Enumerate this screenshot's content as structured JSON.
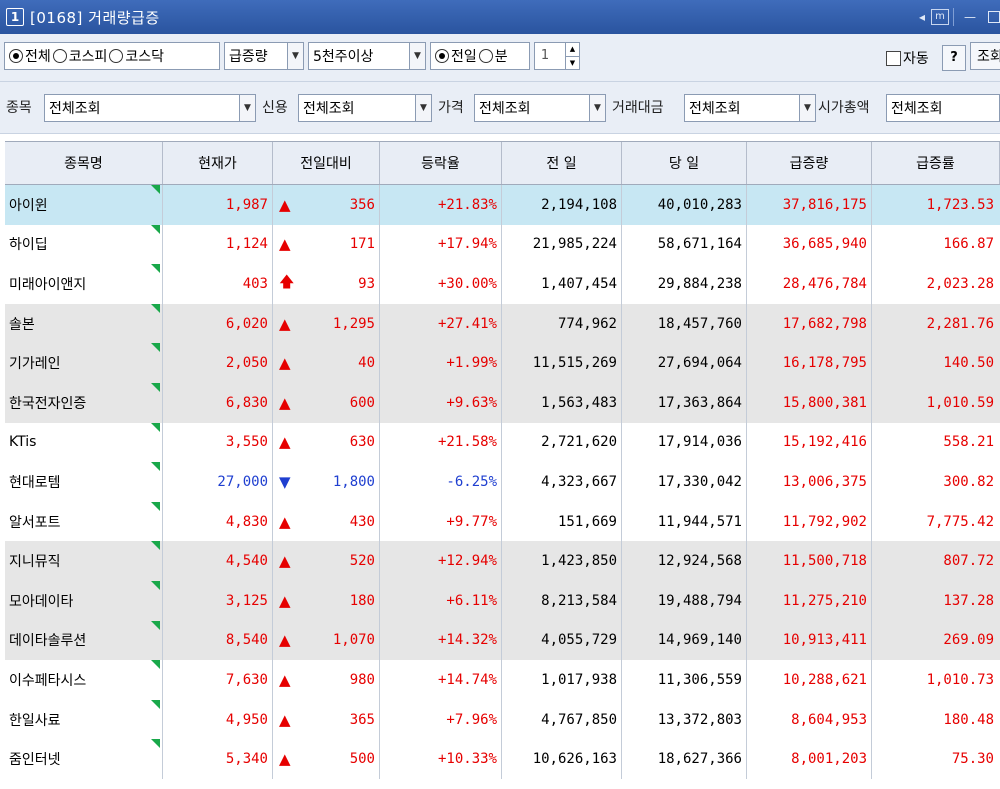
{
  "window": {
    "screen_number": "1",
    "title": "[0168] 거래량급증",
    "m_label": "m",
    "minimize": "—",
    "arrow": "◂"
  },
  "filters1": {
    "market_options": [
      "전체",
      "코스피",
      "코스닥"
    ],
    "market_selected": "전체",
    "sort_select": "급증량",
    "volume_select": "5천주이상",
    "period_options": [
      "전일",
      "분"
    ],
    "period_selected": "전일",
    "minute_value": "1",
    "auto_label": "자동",
    "help_label": "?",
    "query_label": "조회"
  },
  "filters2": {
    "stock_label": "종목",
    "stock_value": "전체조회",
    "credit_label": "신용",
    "credit_value": "전체조회",
    "price_label": "가격",
    "price_value": "전체조회",
    "amount_label": "거래대금",
    "amount_value": "전체조회",
    "cap_label": "시가총액",
    "cap_value": "전체조회"
  },
  "table": {
    "headers": [
      "종목명",
      "현재가",
      "전일대비",
      "등락율",
      "전 일",
      "당 일",
      "급증량",
      "급증률"
    ],
    "rows": [
      {
        "name": "아이윈",
        "price": "1,987",
        "sign": "▲",
        "diff": "356",
        "rate": "+21.83%",
        "prev": "2,194,108",
        "today": "40,010,283",
        "inc": "37,816,175",
        "incr": "1,723.53",
        "dir": "up",
        "bg": "sel"
      },
      {
        "name": "하이딥",
        "price": "1,124",
        "sign": "▲",
        "diff": "171",
        "rate": "+17.94%",
        "prev": "21,985,224",
        "today": "58,671,164",
        "inc": "36,685,940",
        "incr": "166.87",
        "dir": "up",
        "bg": "white"
      },
      {
        "name": "미래아이앤지",
        "price": "403",
        "sign": "🡅",
        "diff": "93",
        "rate": "+30.00%",
        "prev": "1,407,454",
        "today": "29,884,238",
        "inc": "28,476,784",
        "incr": "2,023.28",
        "dir": "up",
        "bg": "white"
      },
      {
        "name": "솔본",
        "price": "6,020",
        "sign": "▲",
        "diff": "1,295",
        "rate": "+27.41%",
        "prev": "774,962",
        "today": "18,457,760",
        "inc": "17,682,798",
        "incr": "2,281.76",
        "dir": "up",
        "bg": "gray"
      },
      {
        "name": "기가레인",
        "price": "2,050",
        "sign": "▲",
        "diff": "40",
        "rate": "+1.99%",
        "prev": "11,515,269",
        "today": "27,694,064",
        "inc": "16,178,795",
        "incr": "140.50",
        "dir": "up",
        "bg": "gray"
      },
      {
        "name": "한국전자인증",
        "price": "6,830",
        "sign": "▲",
        "diff": "600",
        "rate": "+9.63%",
        "prev": "1,563,483",
        "today": "17,363,864",
        "inc": "15,800,381",
        "incr": "1,010.59",
        "dir": "up",
        "bg": "gray"
      },
      {
        "name": "KTis",
        "price": "3,550",
        "sign": "▲",
        "diff": "630",
        "rate": "+21.58%",
        "prev": "2,721,620",
        "today": "17,914,036",
        "inc": "15,192,416",
        "incr": "558.21",
        "dir": "up",
        "bg": "white"
      },
      {
        "name": "현대로템",
        "price": "27,000",
        "sign": "▼",
        "diff": "1,800",
        "rate": "-6.25%",
        "prev": "4,323,667",
        "today": "17,330,042",
        "inc": "13,006,375",
        "incr": "300.82",
        "dir": "down",
        "bg": "white"
      },
      {
        "name": "알서포트",
        "price": "4,830",
        "sign": "▲",
        "diff": "430",
        "rate": "+9.77%",
        "prev": "151,669",
        "today": "11,944,571",
        "inc": "11,792,902",
        "incr": "7,775.42",
        "dir": "up",
        "bg": "white"
      },
      {
        "name": "지니뮤직",
        "price": "4,540",
        "sign": "▲",
        "diff": "520",
        "rate": "+12.94%",
        "prev": "1,423,850",
        "today": "12,924,568",
        "inc": "11,500,718",
        "incr": "807.72",
        "dir": "up",
        "bg": "gray"
      },
      {
        "name": "모아데이타",
        "price": "3,125",
        "sign": "▲",
        "diff": "180",
        "rate": "+6.11%",
        "prev": "8,213,584",
        "today": "19,488,794",
        "inc": "11,275,210",
        "incr": "137.28",
        "dir": "up",
        "bg": "gray"
      },
      {
        "name": "데이타솔루션",
        "price": "8,540",
        "sign": "▲",
        "diff": "1,070",
        "rate": "+14.32%",
        "prev": "4,055,729",
        "today": "14,969,140",
        "inc": "10,913,411",
        "incr": "269.09",
        "dir": "up",
        "bg": "gray"
      },
      {
        "name": "이수페타시스",
        "price": "7,630",
        "sign": "▲",
        "diff": "980",
        "rate": "+14.74%",
        "prev": "1,017,938",
        "today": "11,306,559",
        "inc": "10,288,621",
        "incr": "1,010.73",
        "dir": "up",
        "bg": "white"
      },
      {
        "name": "한일사료",
        "price": "4,950",
        "sign": "▲",
        "diff": "365",
        "rate": "+7.96%",
        "prev": "4,767,850",
        "today": "13,372,803",
        "inc": "8,604,953",
        "incr": "180.48",
        "dir": "up",
        "bg": "white"
      },
      {
        "name": "줌인터넷",
        "price": "5,340",
        "sign": "▲",
        "diff": "500",
        "rate": "+10.33%",
        "prev": "10,626,163",
        "today": "18,627,366",
        "inc": "8,001,203",
        "incr": "75.30",
        "dir": "up",
        "bg": "white"
      }
    ]
  },
  "colors": {
    "up": "#e60000",
    "down": "#1f3fd0",
    "selected_row": "#c7e7f3",
    "title_bar": "#2e5aa8",
    "flag": "#19a84a"
  }
}
